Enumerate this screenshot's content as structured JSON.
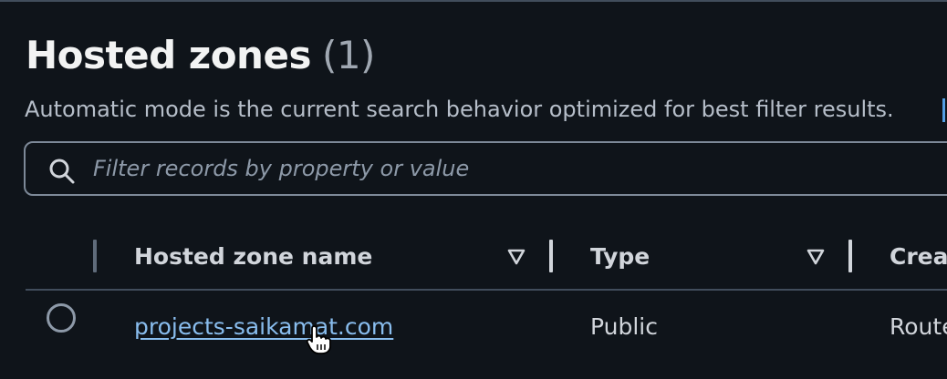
{
  "section": {
    "title": "Hosted zones",
    "count": "(1)",
    "description": "Automatic mode is the current search behavior optimized for best filter results."
  },
  "filter": {
    "placeholder": "Filter records by property or value",
    "icon": "search-icon"
  },
  "table": {
    "columns": [
      {
        "label": "Hosted zone name",
        "sortable": true
      },
      {
        "label": "Type",
        "sortable": true
      },
      {
        "label": "Creat",
        "sortable": false
      }
    ],
    "rows": [
      {
        "selected": false,
        "name": "projects-saikamat.com",
        "type": "Public",
        "created_by": "Route"
      }
    ]
  },
  "colors": {
    "background": "#0f141a",
    "heading": "#f2f3f3",
    "link": "#89bdee",
    "border": "#7d8998"
  }
}
